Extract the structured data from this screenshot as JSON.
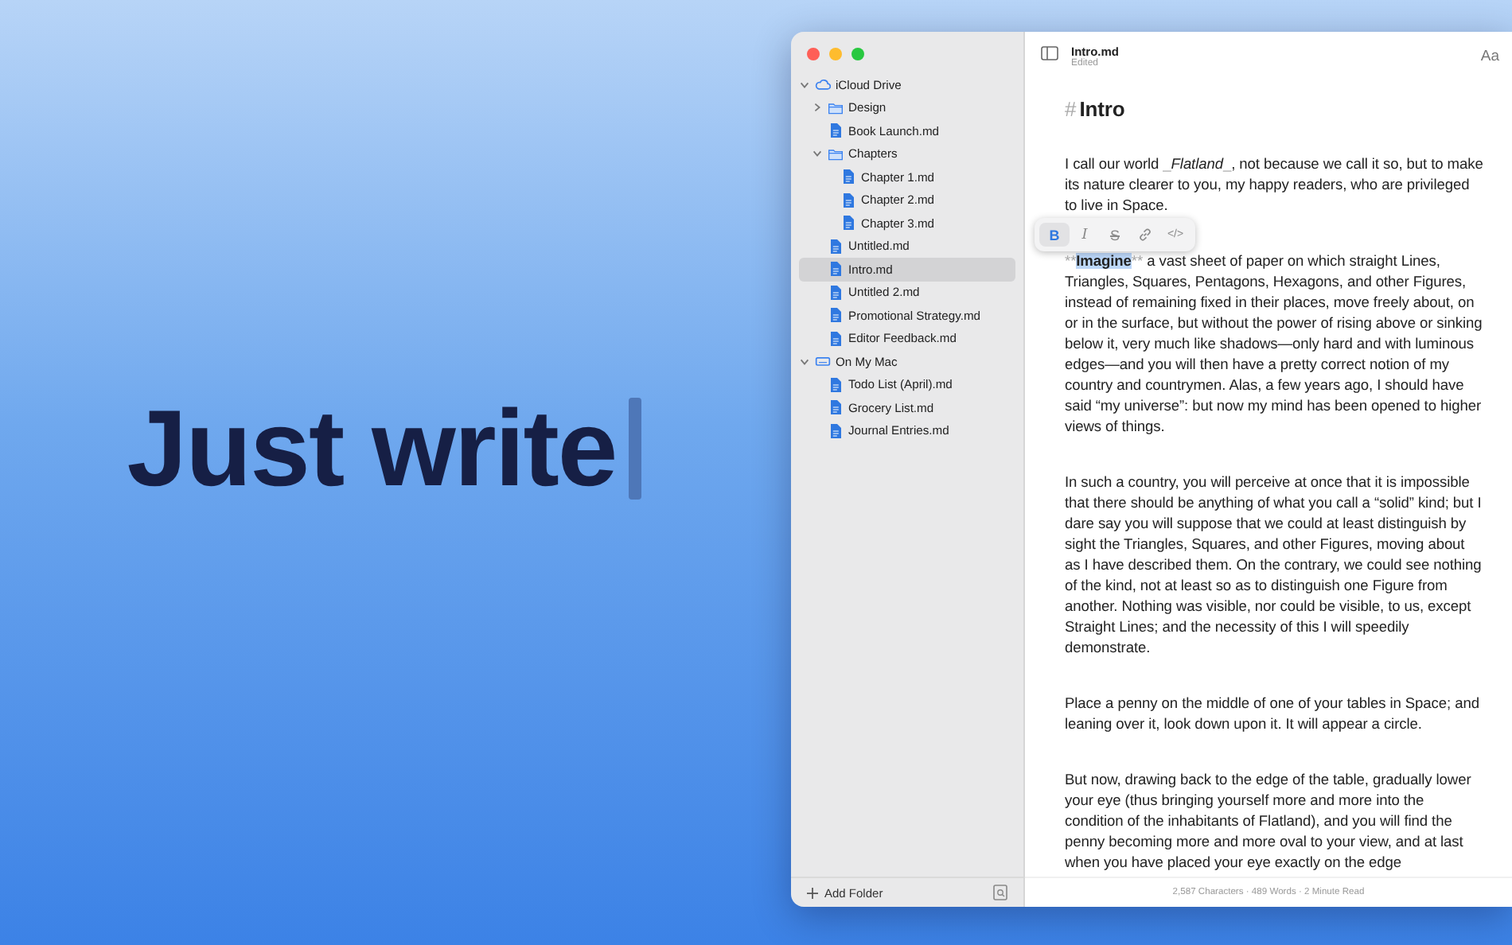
{
  "hero": {
    "headline": "Just write"
  },
  "sidebar": {
    "items": [
      {
        "kind": "location",
        "label": "iCloud Drive",
        "expanded": true,
        "selected": false,
        "children": [
          {
            "kind": "folder",
            "label": "Design",
            "expanded": false,
            "selected": false
          },
          {
            "kind": "file",
            "label": "Book Launch.md",
            "selected": false
          },
          {
            "kind": "folder",
            "label": "Chapters",
            "expanded": true,
            "selected": false,
            "children": [
              {
                "kind": "file",
                "label": "Chapter 1.md",
                "selected": false
              },
              {
                "kind": "file",
                "label": "Chapter 2.md",
                "selected": false
              },
              {
                "kind": "file",
                "label": "Chapter 3.md",
                "selected": false
              }
            ]
          },
          {
            "kind": "file",
            "label": "Untitled.md",
            "selected": false
          },
          {
            "kind": "file",
            "label": "Intro.md",
            "selected": true
          },
          {
            "kind": "file",
            "label": "Untitled 2.md",
            "selected": false
          },
          {
            "kind": "file",
            "label": "Promotional Strategy.md",
            "selected": false
          },
          {
            "kind": "file",
            "label": "Editor Feedback.md",
            "selected": false
          }
        ]
      },
      {
        "kind": "device",
        "label": "On My Mac",
        "expanded": true,
        "selected": false,
        "children": [
          {
            "kind": "file",
            "label": "Todo List (April).md",
            "selected": false
          },
          {
            "kind": "file",
            "label": "Grocery List.md",
            "selected": false
          },
          {
            "kind": "file",
            "label": "Journal Entries.md",
            "selected": false
          }
        ]
      }
    ],
    "add_button": "Add Folder"
  },
  "document": {
    "title": "Intro.md",
    "status": "Edited",
    "font_button": "Aa",
    "heading": {
      "marker": "#",
      "text": "Intro"
    },
    "paragraphs": [
      [
        {
          "kind": "plain",
          "text": "I call our world "
        },
        {
          "kind": "marker",
          "text": "_"
        },
        {
          "kind": "italic",
          "text": "Flatland"
        },
        {
          "kind": "marker",
          "text": "_"
        },
        {
          "kind": "plain",
          "text": ", not because we call it so, but to make its nature clearer to you, my happy readers, who are privileged to live in Space."
        }
      ],
      [
        {
          "kind": "marker",
          "text": "**"
        },
        {
          "kind": "bold",
          "text": "Imagine",
          "selected": true
        },
        {
          "kind": "marker",
          "text": "**"
        },
        {
          "kind": "plain",
          "text": " a vast sheet of paper on which straight Lines, Triangles, Squares, Pentagons, Hexagons, and other Figures, instead of remaining fixed in their places, move freely about, on or in the surface, but without the power of rising above or sinking below it, very much like shadows—only hard and with luminous edges—and you will then have a pretty correct notion of my country and countrymen. Alas, a few years ago, I should have said “my universe”: but now my mind has been opened to higher views of things."
        }
      ],
      [
        {
          "kind": "plain",
          "text": "In such a country, you will perceive at once that it is impossible that there should be anything of what you call a “solid” kind; but I dare say you will suppose that we could at least distinguish by sight the Triangles, Squares, and other Figures, moving about as I have described them. On the contrary, we could see nothing of the kind, not at least so as to distinguish one Figure from another. Nothing was visible, nor could be visible, to us, except Straight Lines; and the necessity of this I will speedily demonstrate."
        }
      ],
      [
        {
          "kind": "plain",
          "text": "Place a penny on the middle of one of your tables in Space; and leaning over it, look down upon it. It will appear a circle."
        }
      ],
      [
        {
          "kind": "plain",
          "text": "But now, drawing back to the edge of the table, gradually lower your eye (thus bringing yourself more and more into the condition of the inhabitants of Flatland), and you will find the penny becoming more and more oval to your view, and at last when you have placed your eye exactly on the edge"
        }
      ]
    ],
    "format_toolbar": [
      {
        "kind": "bold",
        "label": "B",
        "selected": true
      },
      {
        "kind": "italic",
        "label": "I",
        "selected": false
      },
      {
        "kind": "strike",
        "label": "S",
        "selected": false
      },
      {
        "kind": "link",
        "selected": false
      },
      {
        "kind": "code",
        "label": "</>",
        "selected": false
      }
    ],
    "stats": "2,587 Characters · 489 Words · 2 Minute Read"
  }
}
